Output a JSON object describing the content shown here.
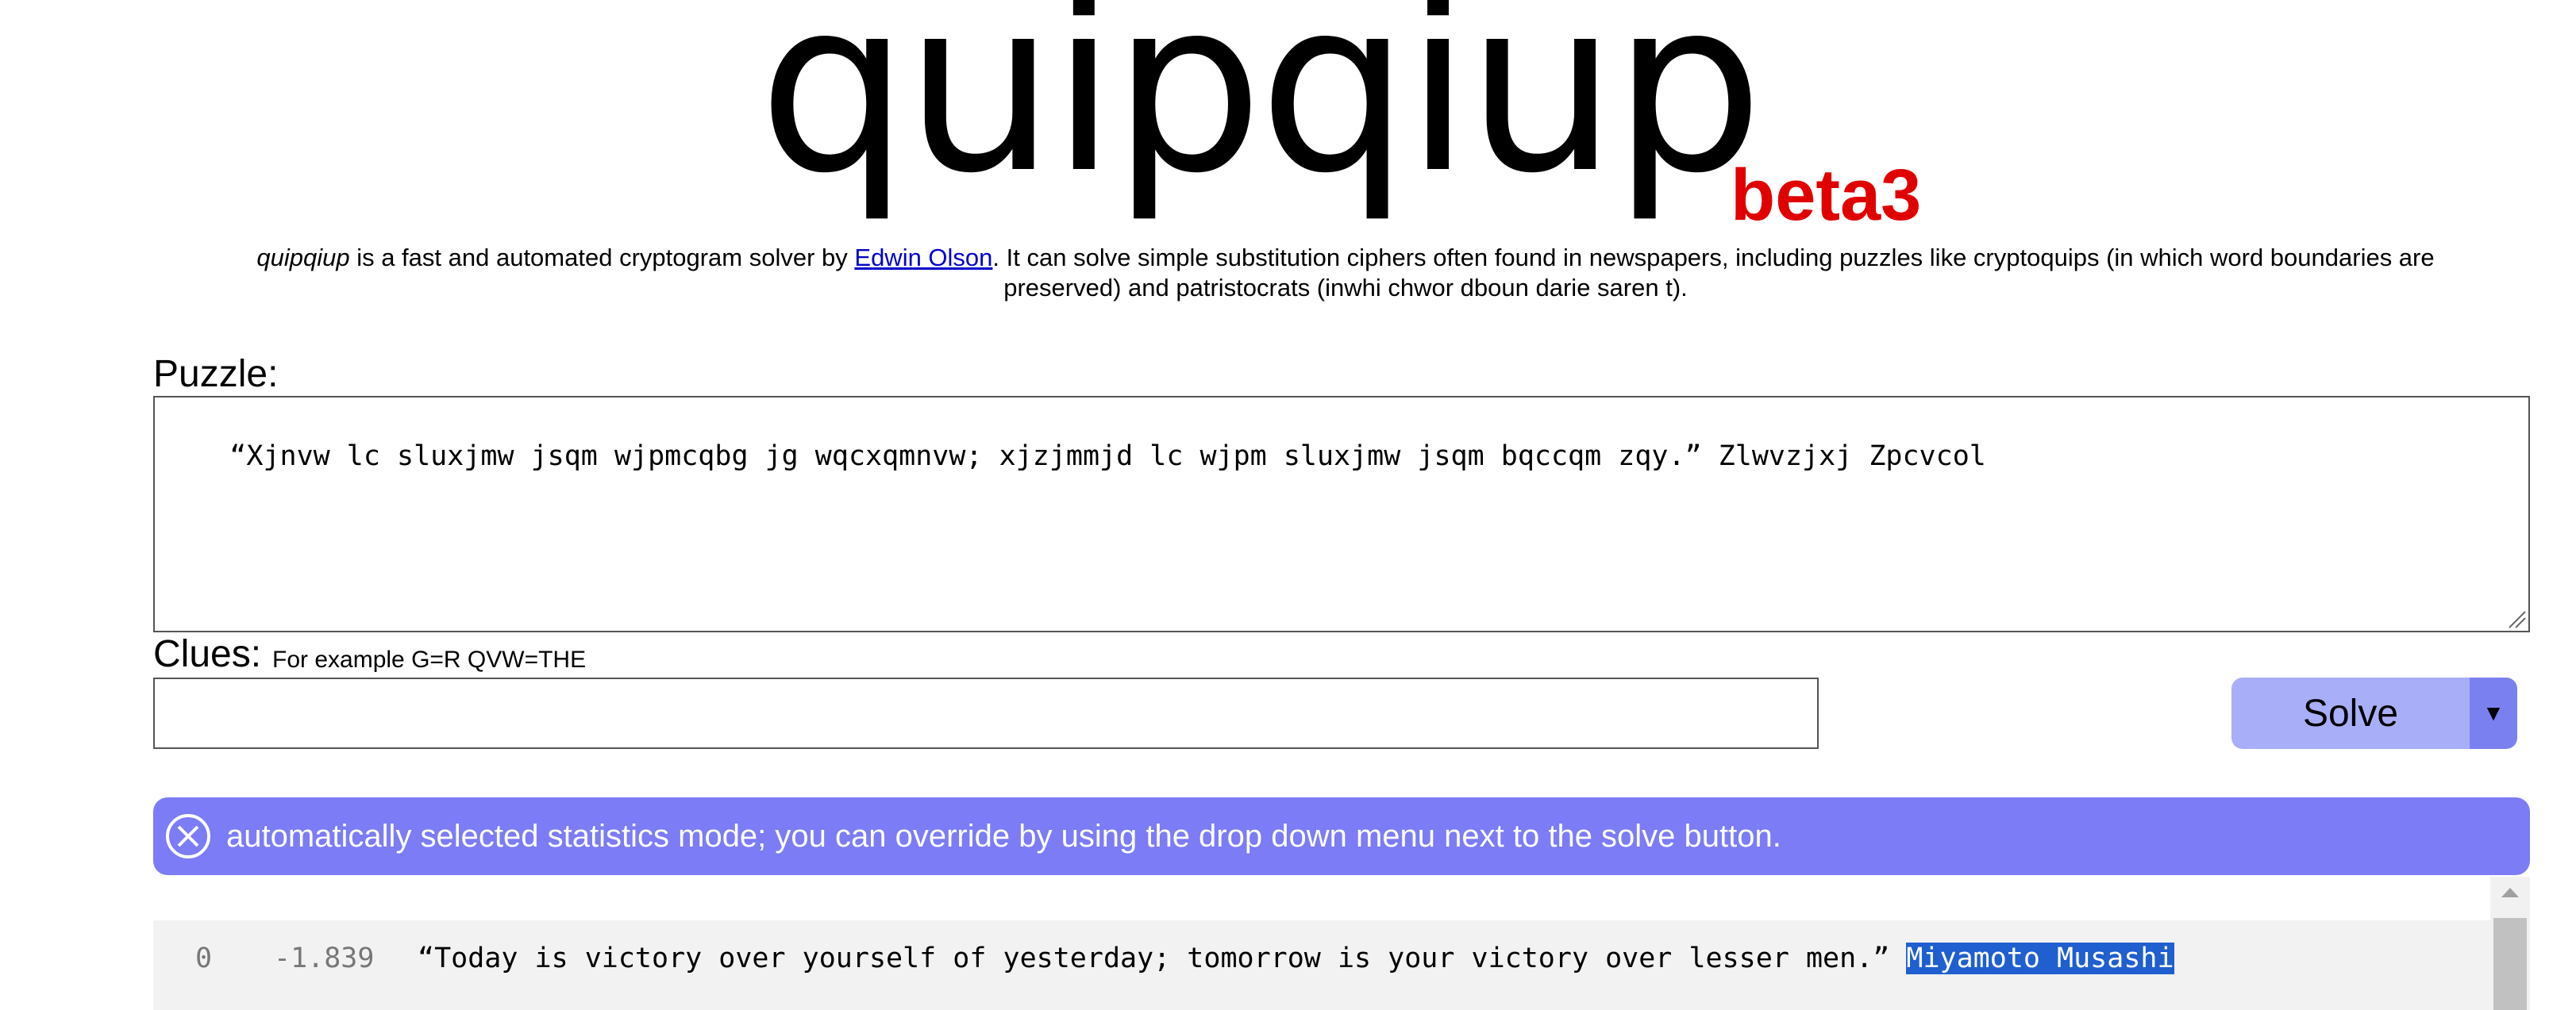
{
  "header": {
    "logo_text": "quipqiup",
    "beta_label": "beta3"
  },
  "intro": {
    "app_name": "quipqiup",
    "text_before_link": " is a fast and automated cryptogram solver by ",
    "author_link": "Edwin Olson",
    "text_after_link": ". It can solve simple substitution ciphers often found in newspapers, including puzzles like cryptoquips (in which word boundaries are preserved) and patristocrats (inwhi chwor dboun darie saren t)."
  },
  "puzzle": {
    "label": "Puzzle:",
    "value": "“Xjnvw lc sluxjmw jsqm wjpmcqbg jg wqcxqmnvw; xjzjmmjd lc wjpm sluxjmw jsqm bqccqm zqy.” Zlwvzjxj Zpcvcol"
  },
  "clues": {
    "label": "Clues:",
    "hint": "For example G=R QVW=THE",
    "value": ""
  },
  "solve": {
    "label": "Solve",
    "dropdown_glyph": "▼"
  },
  "banner": {
    "icon": "close-circle-icon",
    "message": "automatically selected statistics mode; you can override by using the drop down menu next to the solve button."
  },
  "results": [
    {
      "index": "0",
      "score": "-1.839",
      "text": "“Today is victory over yourself of yesterday; tomorrow is your victory over lesser men.” ",
      "selected_text": "Miyamoto Musashi"
    }
  ],
  "colors": {
    "beta": "#e00000",
    "solve_button": "#a9aef8",
    "solve_dropdown": "#7b80f0",
    "banner": "#7b7cf6",
    "link": "#0000cc",
    "selection": "#1f5fcf"
  }
}
